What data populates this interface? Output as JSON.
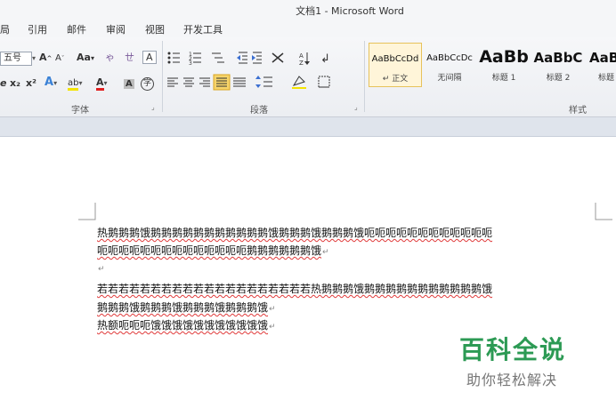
{
  "window": {
    "title": "文档1 - Microsoft Word"
  },
  "menu": {
    "tabs": [
      {
        "label": "局"
      },
      {
        "label": "引用"
      },
      {
        "label": "邮件"
      },
      {
        "label": "审阅"
      },
      {
        "label": "视图"
      },
      {
        "label": "开发工具"
      }
    ]
  },
  "ribbon": {
    "font_group": {
      "label": "字体",
      "font_size": "五号",
      "grow_font": "A",
      "shrink_font": "A",
      "change_case": "Aa",
      "phonetic": "ㄝ",
      "char_border": "A",
      "clear_format": "ゃ",
      "subscript": "x₂",
      "superscript": "x²",
      "text_effect": "A",
      "highlight": "ab",
      "font_color": "A",
      "char_shading": "A",
      "enclose": "字"
    },
    "paragraph_group": {
      "label": "段落"
    },
    "styles_group": {
      "label": "样式",
      "items": [
        {
          "sample": "AaBbCcDd",
          "name": "↵ 正文"
        },
        {
          "sample": "AaBbCcDc",
          "name": "无间隔"
        },
        {
          "sample": "AaBb",
          "name": "标题 1"
        },
        {
          "sample": "AaBbC",
          "name": "标题 2"
        },
        {
          "sample": "AaB",
          "name": "标题"
        }
      ]
    },
    "accent_color": "#e7c25b"
  },
  "document": {
    "lines": [
      {
        "text": "热鹅鹅鹅饿鹅鹅鹅鹅鹅鹅鹅鹅鹅鹅鹅饿鹅鹅鹅饿鹅鹅鹅饿呃呃呃呃呃呃呃呃呃呃呃呃",
        "mark": ""
      },
      {
        "text": "呃呃呃呃呃呃呃呃呃呃呃呃呃呃鹅鹅鹅鹅鹅鹅饿",
        "mark": "↵"
      },
      {
        "text": "",
        "mark": "↵"
      },
      {
        "text": "若若若若若若若若若若若若若若若若若若若若热鹅鹅鹅饿鹅鹅鹅鹅鹅鹅鹅鹅鹅鹅鹅饿",
        "mark": ""
      },
      {
        "text": "鹅鹅鹅饿鹅鹅鹅饿鹅鹅鹅饿鹅鹅鹅饿",
        "mark": "↵"
      },
      {
        "text": "热额呃呃呃饿饿饿饿饿饿饿饿饿饿饿",
        "mark": "↵"
      }
    ]
  },
  "watermark": {
    "title": "百科全说",
    "subtitle": "助你轻松解决"
  }
}
